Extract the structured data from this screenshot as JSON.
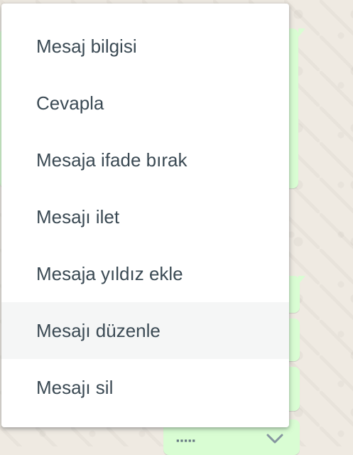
{
  "context_menu": {
    "items": [
      {
        "label": "Mesaj bilgisi",
        "hovered": false
      },
      {
        "label": "Cevapla",
        "hovered": false
      },
      {
        "label": "Mesaja ifade bırak",
        "hovered": false
      },
      {
        "label": "Mesajı ilet",
        "hovered": false
      },
      {
        "label": "Mesaja yıldız ekle",
        "hovered": false
      },
      {
        "label": "Mesajı düzenle",
        "hovered": true
      },
      {
        "label": "Mesajı sil",
        "hovered": false
      }
    ]
  },
  "background": {
    "bubble_color": "#d9fdd3",
    "wallpaper_color": "#efeae2",
    "menu_hover_color": "#f5f6f6",
    "menu_text_color": "#3b4a54",
    "scroll_icon": "chevron-down-icon"
  }
}
